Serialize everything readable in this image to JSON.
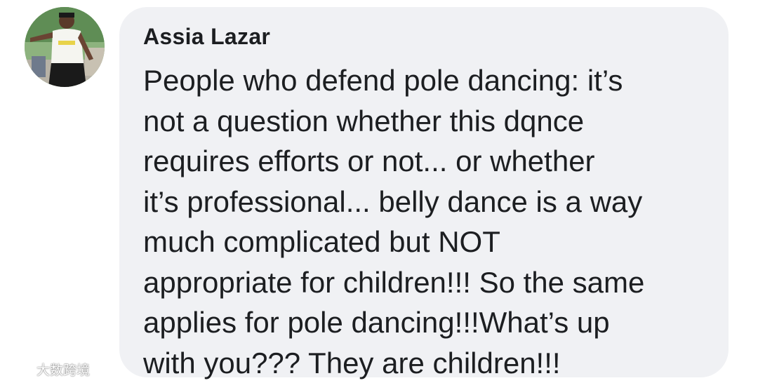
{
  "comment": {
    "author_name": "Assia Lazar",
    "lines": [
      "People who defend pole dancing: it’s",
      "not a question whether this dqnce",
      "requires efforts or not... or whether",
      "it’s professional... belly dance is a way",
      "much complicated but NOT",
      "appropriate for children!!! So the same",
      "applies for pole dancing!!!What’s up",
      "with you??? They are children!!!"
    ]
  },
  "watermark": {
    "text": "大数跨境"
  },
  "colors": {
    "bubble_background": "#f0f1f4",
    "text": "#1c1e21"
  },
  "icons": {
    "avatar": "profile-photo",
    "watermark_logo": "weibo-logo-icon"
  }
}
